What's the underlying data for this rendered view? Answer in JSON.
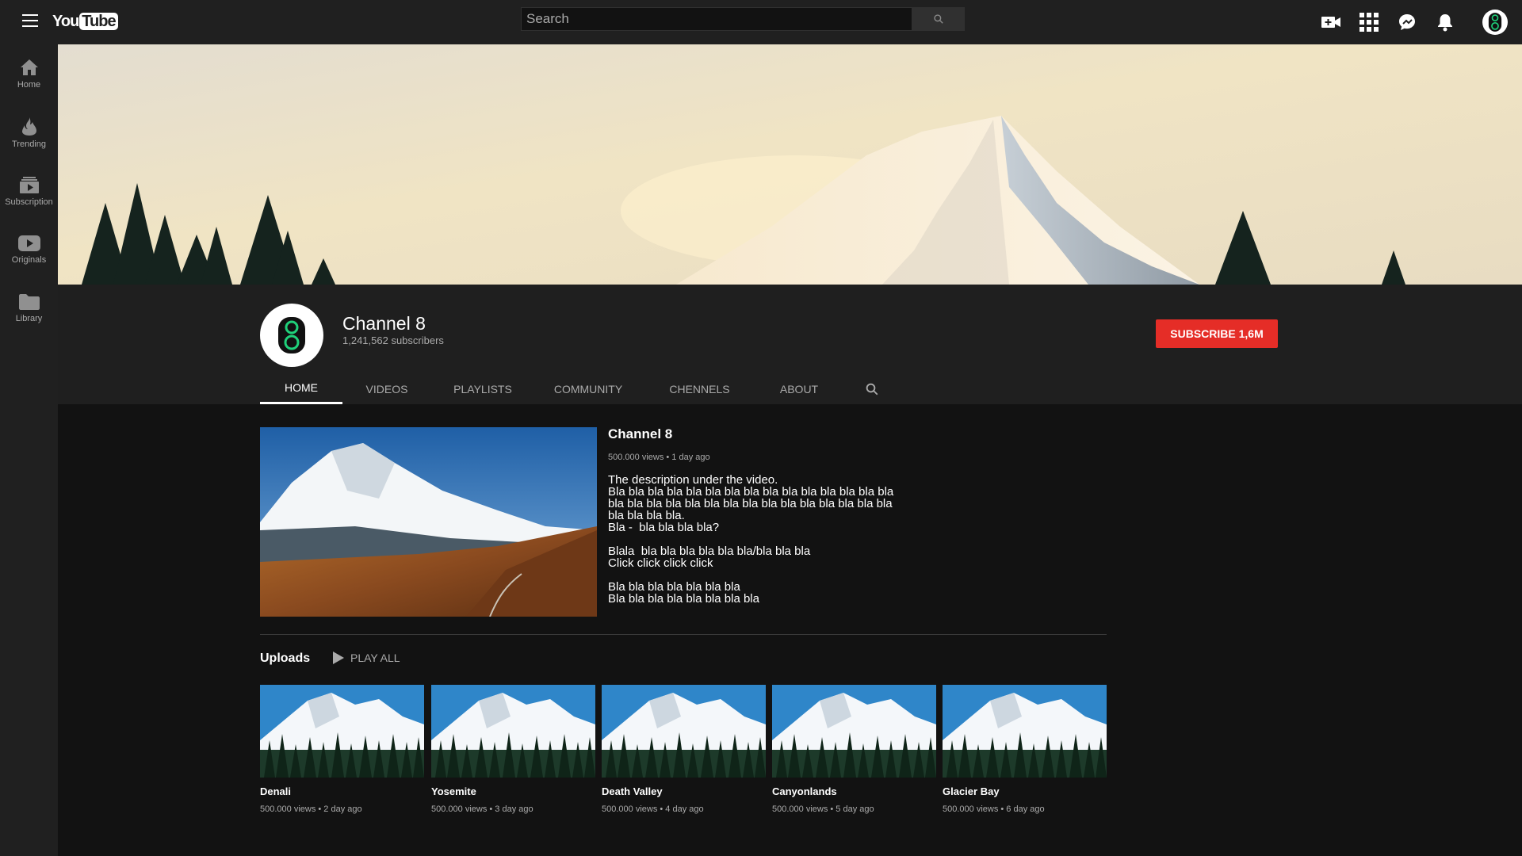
{
  "header": {
    "logo_you": "You",
    "logo_tube": "Tube",
    "search_placeholder": "Search",
    "icons": [
      "create-video-icon",
      "apps-grid-icon",
      "messages-icon",
      "notifications-bell-icon",
      "account-avatar-icon"
    ]
  },
  "sidebar": {
    "items": [
      {
        "label": "Home",
        "icon": "home-icon"
      },
      {
        "label": "Trending",
        "icon": "flame-icon"
      },
      {
        "label": "Subscription",
        "icon": "subscriptions-icon"
      },
      {
        "label": "Originals",
        "icon": "originals-play-icon"
      },
      {
        "label": "Library",
        "icon": "folder-icon"
      }
    ]
  },
  "channel": {
    "name": "Channel 8",
    "subscribers": "1,241,562 subscribers",
    "subscribe_label": "SUBSCRIBE 1,6M",
    "tabs": [
      "HOME",
      "VIDEOS",
      "PLAYLISTS",
      "COMMUNITY",
      "CHENNELS",
      "ABOUT"
    ],
    "active_tab": "HOME"
  },
  "featured": {
    "title": "Channel 8",
    "meta": "500.000 views • 1 day ago",
    "description": [
      "The description under the video.",
      "Bla bla bla bla bla bla bla bla bla bla bla bla bla bla bla bla bla bla bla bla bla bla bla bla bla bla bla bla bla bla bla bla bla bla.",
      "Bla -  bla bla bla bla?",
      "",
      "Blala  bla bla bla bla bla bla/bla bla bla",
      "Click click click click",
      "",
      "Bla bla bla bla bla bla bla",
      "Bla bla bla bla bla bla bla bla"
    ]
  },
  "uploads": {
    "title": "Uploads",
    "play_all": "PLAY ALL",
    "items": [
      {
        "title": "Denali",
        "meta": "500.000 views • 2 day ago"
      },
      {
        "title": "Yosemite",
        "meta": "500.000 views • 3 day ago"
      },
      {
        "title": "Death Valley",
        "meta": "500.000 views • 4 day ago"
      },
      {
        "title": "Canyonlands",
        "meta": "500.000 views • 5 day ago"
      },
      {
        "title": "Glacier Bay",
        "meta": "500.000 views • 6 day ago"
      }
    ]
  },
  "colors": {
    "background": "#121212",
    "topbar": "#202020",
    "header_panel": "#1f1f1f",
    "subscribe_red": "#e52d27",
    "muted_text": "#aaaaaa"
  }
}
